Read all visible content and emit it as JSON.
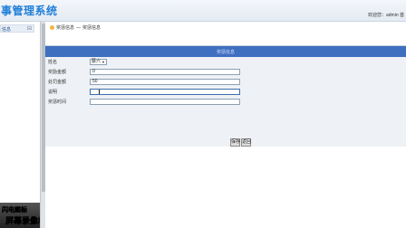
{
  "header": {
    "app_title": "事管理系统",
    "user_info": "欢迎您：admin 首"
  },
  "sidebar": {
    "item_label": "信息",
    "toggle": "⊟"
  },
  "breadcrumb": {
    "first": "奖惩信息",
    "separator": "—",
    "second": "奖惩信息"
  },
  "form": {
    "heading": "奖惩信息",
    "fields": [
      {
        "label": "姓名",
        "type": "select",
        "value": "蔡六"
      },
      {
        "label": "奖励金额",
        "type": "text",
        "value": "0"
      },
      {
        "label": "处罚金额",
        "type": "text",
        "value": "50"
      },
      {
        "label": "说明",
        "type": "text",
        "value": ""
      },
      {
        "label": "奖惩时间",
        "type": "text",
        "value": ""
      }
    ],
    "buttons": {
      "save": "保存",
      "back": "返回"
    }
  },
  "watermark": {
    "line1": "闪电图标",
    "line2": "屏幕录像机"
  }
}
